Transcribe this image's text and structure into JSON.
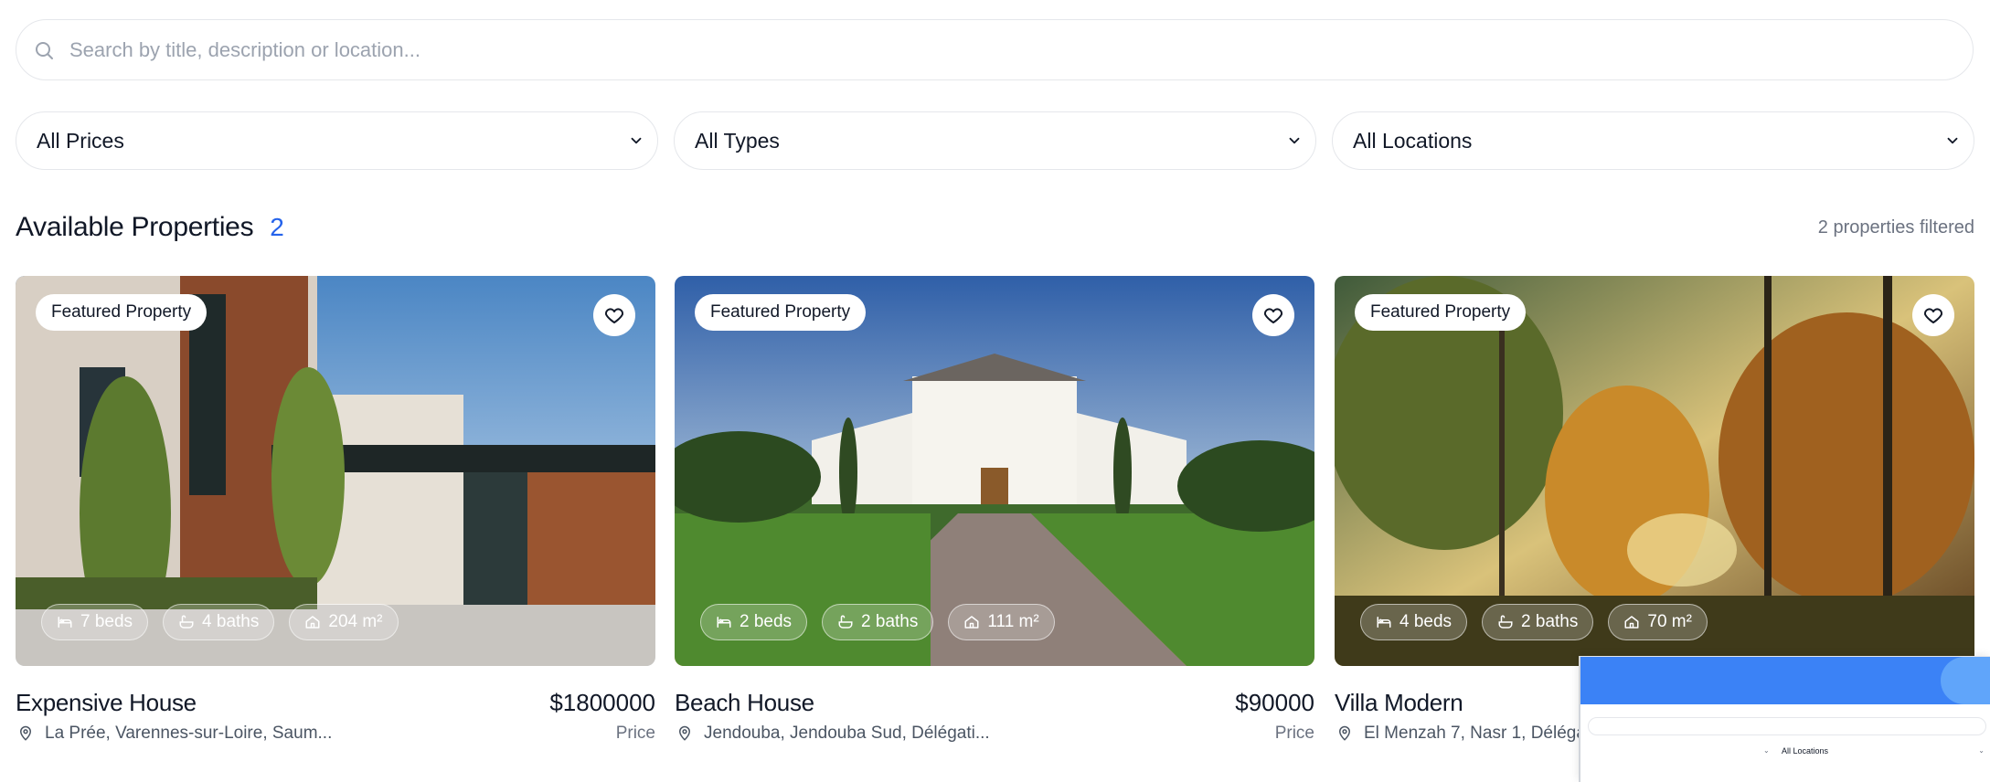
{
  "search": {
    "placeholder": "Search by title, description or location..."
  },
  "filters": {
    "price": "All Prices",
    "type": "All Types",
    "location": "All Locations"
  },
  "section": {
    "title": "Available Properties",
    "count": "2",
    "filtered_note": "2 properties filtered"
  },
  "cards": [
    {
      "badge": "Featured Property",
      "beds": "7 beds",
      "baths": "4 baths",
      "area": "204 m²",
      "title": "Expensive House",
      "price": "$1800000",
      "price_label": "Price",
      "location": "La Prée, Varennes-sur-Loire, Saum..."
    },
    {
      "badge": "Featured Property",
      "beds": "2 beds",
      "baths": "2 baths",
      "area": "111 m²",
      "title": "Beach House",
      "price": "$90000",
      "price_label": "Price",
      "location": "Jendouba, Jendouba Sud, Délégati..."
    },
    {
      "badge": "Featured Property",
      "beds": "4 beds",
      "baths": "2 baths",
      "area": "70 m²",
      "title": "Villa Modern",
      "price": "",
      "price_label": "",
      "location": "El Menzah 7, Nasr 1, Déléga"
    }
  ],
  "popup": {
    "select_value": "All Locations"
  },
  "icons": {
    "search": "search-icon",
    "chevron": "chevron-down-icon",
    "heart": "heart-icon",
    "bed": "bed-icon",
    "bath": "bath-icon",
    "area": "home-icon",
    "location": "map-pin-icon"
  },
  "colors": {
    "accent": "#2563eb",
    "popup_header": "#3b82f6"
  }
}
